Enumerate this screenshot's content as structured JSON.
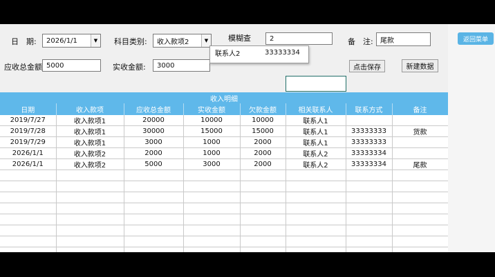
{
  "form": {
    "date_label": "日　期:",
    "date_value": "2026/1/1",
    "category_label": "科目类别:",
    "category_value": "收入款项2",
    "fuzzy_label": "模糊查",
    "fuzzy_value": "2",
    "remark_label": "备　注:",
    "remark_value": "尾款",
    "total_label": "应收总金额:",
    "total_value": "5000",
    "actual_label": "实收金额:",
    "actual_value": "3000",
    "save_button": "点击保存",
    "new_button": "新建数据",
    "return_button": "返回菜单"
  },
  "suggestion": {
    "contact": "联系人2",
    "phone": "33333334"
  },
  "grid": {
    "title": "收入明细",
    "headers": [
      "日期",
      "收入款项",
      "应收总金额",
      "实收金额",
      "欠款金额",
      "相关联系人",
      "联系方式",
      "备注"
    ],
    "rows": [
      [
        "2019/7/27",
        "收入款项1",
        "20000",
        "10000",
        "10000",
        "联系人1",
        "",
        ""
      ],
      [
        "2019/7/28",
        "收入款项1",
        "30000",
        "15000",
        "15000",
        "联系人1",
        "33333333",
        "货款"
      ],
      [
        "2019/7/29",
        "收入款项1",
        "3000",
        "1000",
        "2000",
        "联系人1",
        "33333333",
        ""
      ],
      [
        "2026/1/1",
        "收入款项2",
        "2000",
        "1000",
        "2000",
        "联系人2",
        "33333334",
        ""
      ],
      [
        "2026/1/1",
        "收入款项2",
        "5000",
        "3000",
        "2000",
        "联系人2",
        "33333334",
        "尾款"
      ]
    ],
    "empty_rows": 9
  }
}
